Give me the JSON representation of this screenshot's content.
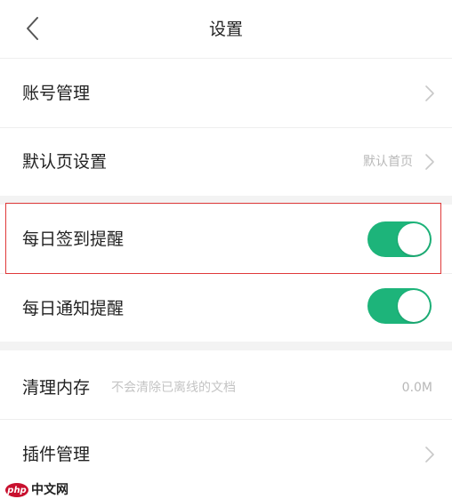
{
  "header": {
    "title": "设置",
    "back_icon": "chevron-left-icon"
  },
  "rows": {
    "account": {
      "label": "账号管理",
      "icon": "chevron-right-icon"
    },
    "default_page": {
      "label": "默认页设置",
      "value": "默认首页",
      "icon": "chevron-right-icon"
    },
    "checkin_reminder": {
      "label": "每日签到提醒",
      "enabled": true
    },
    "notify_reminder": {
      "label": "每日通知提醒",
      "enabled": true
    },
    "clear_cache": {
      "label": "清理内存",
      "hint": "不会清除已离线的文档",
      "value": "0.0M"
    },
    "plugins": {
      "label": "插件管理",
      "icon": "chevron-right-icon"
    }
  },
  "colors": {
    "toggle_on": "#1db47a",
    "highlight_border": "#e0393a",
    "divider": "#eeeeee",
    "section_gap": "#f3f3f3"
  },
  "watermark": {
    "badge": "php",
    "text": "中文网"
  }
}
